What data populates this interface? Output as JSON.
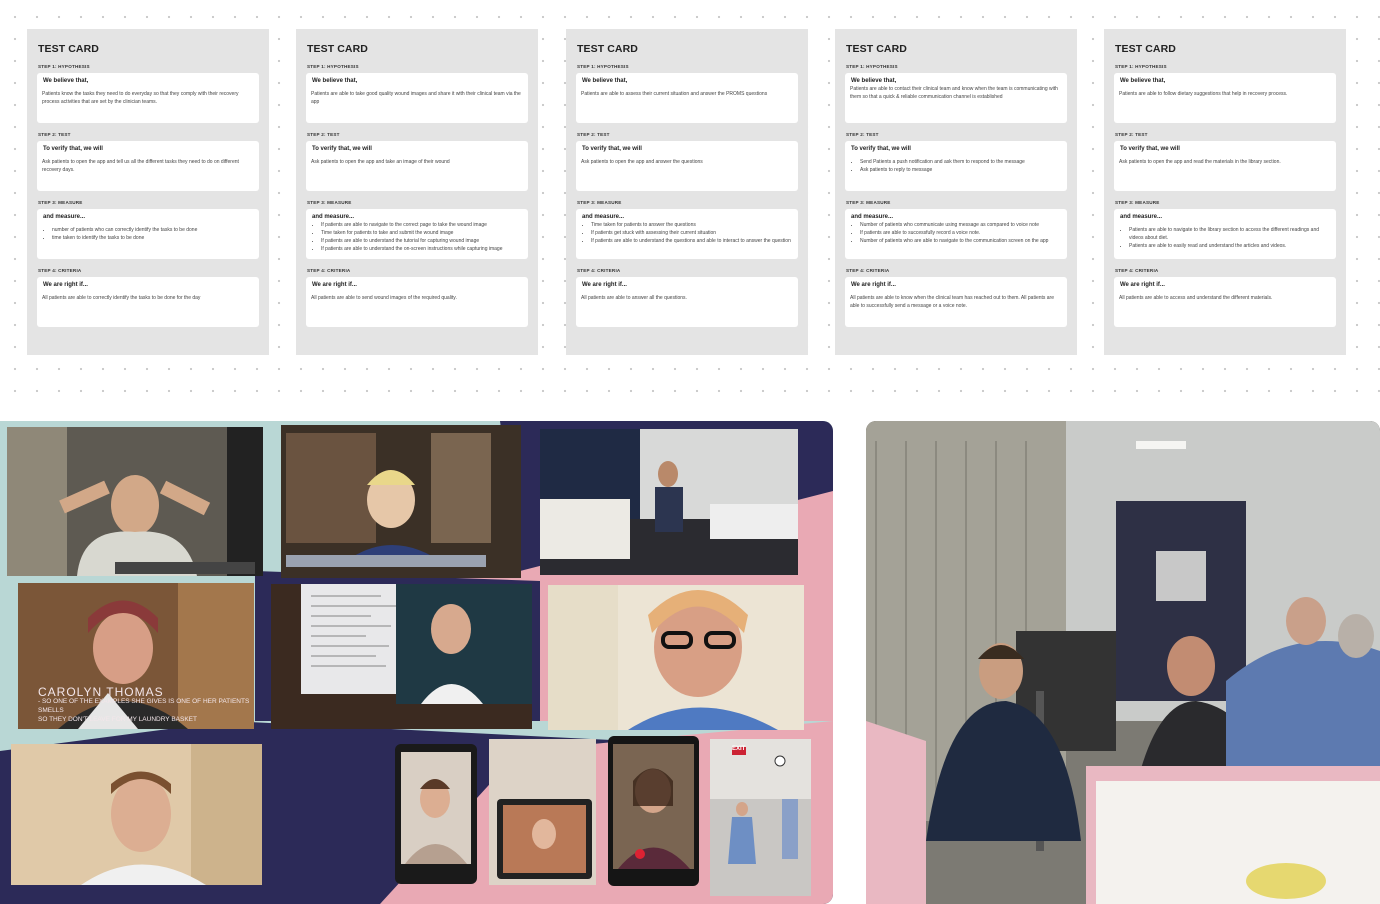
{
  "cards": [
    {
      "title": "TEST CARD",
      "step1_label": "STEP 1: HYPOTHESIS",
      "step1_head": "We believe that,",
      "step1_text": "Patients know the tasks they need to do everyday so that they comply with their recovery process activities that are set by the clinician teams.",
      "step2_label": "STEP 2: TEST",
      "step2_head": "To verify that, we will",
      "step2_text": "Ask patients to open the app and tell us all the different tasks they need to do on different recovery days.",
      "step3_label": "STEP 3: MEASURE",
      "step3_head": "and measure...",
      "step3_items": [
        "number of patients who can correctly identify the tasks to be done",
        "time taken to identify the tasks to be done"
      ],
      "step4_label": "STEP 4: CRITERIA",
      "step4_head": "We are right if...",
      "step4_text": "All patients are able to correctly identify the tasks to be done for the day"
    },
    {
      "title": "TEST CARD",
      "step1_label": "STEP 1: HYPOTHESIS",
      "step1_head": "We believe that,",
      "step1_text": "Patients are able to take good quality wound images and share it with their clinical team via the app",
      "step2_label": "STEP 2: TEST",
      "step2_head": "To verify that, we will",
      "step2_text": "Ask patients to open the app and take an image of their wound",
      "step3_label": "STEP 3: MEASURE",
      "step3_head": "and measure...",
      "step3_items": [
        "If patients are able to navigate to the correct page to take the wound image",
        "Time taken for patients to take and submit the wound image",
        "If patients are able to understand the tutorial for capturing wound image",
        "If patients are able to understand the on-screen instructions while capturing image"
      ],
      "step4_label": "STEP 4: CRITERIA",
      "step4_head": "We are right if...",
      "step4_text": "All patients are able to send wound images of the required quality."
    },
    {
      "title": "TEST CARD",
      "step1_label": "STEP 1: HYPOTHESIS",
      "step1_head": "We believe that,",
      "step1_text": "Patients are able to assess their current situation and answer the PROMS questions",
      "step2_label": "STEP 2: TEST",
      "step2_head": "To verify that, we will",
      "step2_text": "Ask patients to open the app and answer the questions",
      "step3_label": "STEP 3: MEASURE",
      "step3_head": "and measure...",
      "step3_items": [
        "Time taken for patients to answer the questions",
        "If patients get stuck with assessing their current situation",
        "If patients are able to understand the questions and able to interact to answer the question"
      ],
      "step4_label": "STEP 4: CRITERIA",
      "step4_head": "We are right if...",
      "step4_text": "All patients are able to answer all the questions."
    },
    {
      "title": "TEST CARD",
      "step1_label": "STEP 1: HYPOTHESIS",
      "step1_head": "We believe that,",
      "step1_text": "Patients are able to contact their clinical team and know when the team is communicating with them so that a quick & reliable communication channel is established",
      "step2_label": "STEP 2: TEST",
      "step2_head": "To verify that, we will",
      "step2_items": [
        "Send Patients a push notification and ask them to respond to the message",
        "Ask patients to reply to message"
      ],
      "step3_label": "STEP 3: MEASURE",
      "step3_head": "and measure...",
      "step3_items": [
        "Number of patients who communicate using message as compared to voice note",
        "If patients are able to successfully record a voice note.",
        "Number of patients who are able to navigate to the communication screen on the app"
      ],
      "step4_label": "STEP 4: CRITERIA",
      "step4_head": "We are right if...",
      "step4_text": "All patients are able to know when the clinical team has reached out to them. All patients are able to successfully send a message or a voice note."
    },
    {
      "title": "TEST CARD",
      "step1_label": "STEP 1: HYPOTHESIS",
      "step1_head": "We believe that,",
      "step1_text": "Patients are able to follow dietary suggestions that help in recovery process.",
      "step2_label": "STEP 2: TEST",
      "step2_head": "To verify that, we will",
      "step2_text": "Ask patients to open the app and read the materials in the library section.",
      "step3_label": "STEP 3: MEASURE",
      "step3_head": "and measure...",
      "step3_items": [
        "Patients are able to navigate to the library section to access the different readings and videos about diet.",
        "Patients are able to easily read and understand the articles and videos."
      ],
      "step4_label": "STEP 4: CRITERIA",
      "step4_head": "We are right if...",
      "step4_text": "All patients are able to access and understand the different materials."
    }
  ],
  "collage": {
    "caption_name": "CAROLYN THOMAS",
    "caption_line1": "- SO ONE OF THE EXAMPLES SHE GIVES IS ONE OF HER PATIENTS SMELLS",
    "caption_line2": "SO THEY DON'T LEAVE FOR MY LAUNDRY BASKET",
    "exit_sign": "EXIT"
  },
  "colors": {
    "card_bg": "#e4e4e4",
    "teal": "#b9d7d5",
    "navy": "#2c2a58",
    "pink": "#e9a9b4"
  }
}
